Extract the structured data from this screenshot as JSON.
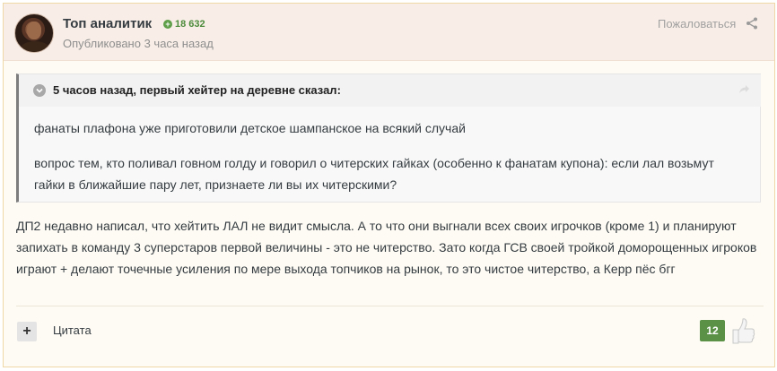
{
  "author": {
    "name": "Топ аналитик",
    "reputation": "18 632",
    "posted": "Опубликовано 3 часа назад"
  },
  "header": {
    "report_label": "Пожаловаться"
  },
  "quote": {
    "citation": "5 часов назад, первый хейтер на деревне сказал:",
    "paragraphs": [
      "фанаты плафона уже приготовили детское шампанское на всякий случай",
      "вопрос тем, кто поливал говном голду и говорил о читерских гайках (особенно к фанатам купона): если лал возьмут гайки в ближайшие пару лет, признаете ли вы их читерскими?"
    ]
  },
  "body": {
    "text": "ДП2 недавно написал, что хейтить ЛАЛ не видит смысла. А то что они выгнали всех своих игрочков (кроме 1) и планируют запихать в команду 3 суперстаров первой величины - это не читерство. Зато когда ГСВ своей тройкой доморощенных игроков играют + делают точечные усиления по мере выхода топчиков на рынок, то это чистое читерство, а Керр пёс бгг"
  },
  "footer": {
    "quote_plus": "+",
    "quote_label": "Цитата",
    "reputation_count": "12"
  },
  "colors": {
    "header_bg": "#f9eee7",
    "post_border": "#efd7a6",
    "reputation_green": "#5a9146",
    "quote_border": "#7d7d7d"
  },
  "icons": [
    "avatar",
    "reputation-plus-icon",
    "share-icon",
    "quote-toggle-icon",
    "quote-share-icon",
    "like-icon"
  ]
}
